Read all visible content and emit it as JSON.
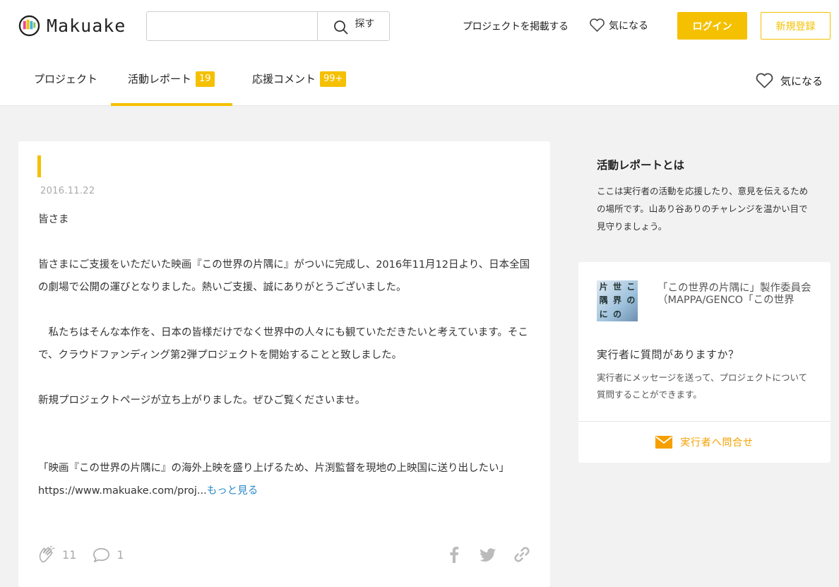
{
  "header": {
    "logo_text": "Makuake",
    "search": {
      "placeholder": "",
      "button_label": "探す"
    },
    "post_project": "プロジェクトを掲載する",
    "favorites": "気になる",
    "login": "ログイン",
    "signup": "新規登録"
  },
  "tabs": [
    {
      "label": "プロジェクト",
      "badge": ""
    },
    {
      "label": "活動レポート",
      "badge": "19",
      "active": true
    },
    {
      "label": "応援コメント",
      "badge": "99+"
    }
  ],
  "tab_favorite": "気になる",
  "report": {
    "date": "2016.11.22",
    "paragraphs": [
      "皆さま",
      "皆さまにご支援をいただいた映画『この世界の片隅に』がついに完成し、2016年11月12日より、日本全国の劇場で公開の運びとなりました。熱いご支援、誠にありがとうございました。",
      "　私たちはそんな本作を、日本の皆様だけでなく世界中の人々にも観ていただきたいと考えています。そこで、クラウドファンディング第2弾プロジェクトを開始することと致しました。",
      "新規プロジェクトページが立ち上がりました。ぜひご覧くださいませ。",
      "「映画『この世界の片隅に』の海外上映を盛り上げるため、片渕監督を現地の上映国に送り出したい」"
    ],
    "url_text": "https://www.makuake.com/proj...",
    "more_link": "もっと見る",
    "cheer_count": "11",
    "comment_count": "1"
  },
  "sidebar": {
    "about_title": "活動レポートとは",
    "about_desc": "ここは実行者の活動を応援したり、意見を伝えるための場所です。山あり谷ありのチャレンジを温かい目で見守りましょう。",
    "owner_thumb_chars": [
      "片",
      "世",
      "こ",
      "隅",
      "界",
      "の",
      "に",
      "の",
      ""
    ],
    "owner_name": "「この世界の片隅に」製作委員会（MAPPA/GENCO「この世界",
    "question_title": "実行者に質問がありますか？",
    "question_desc": "実行者にメッセージを送って、プロジェクトについて質問することができます。",
    "contact_label": "実行者へ問合せ"
  },
  "colors": {
    "accent": "#f5c000",
    "link": "#2a8ac8",
    "contact": "#f5a000"
  }
}
